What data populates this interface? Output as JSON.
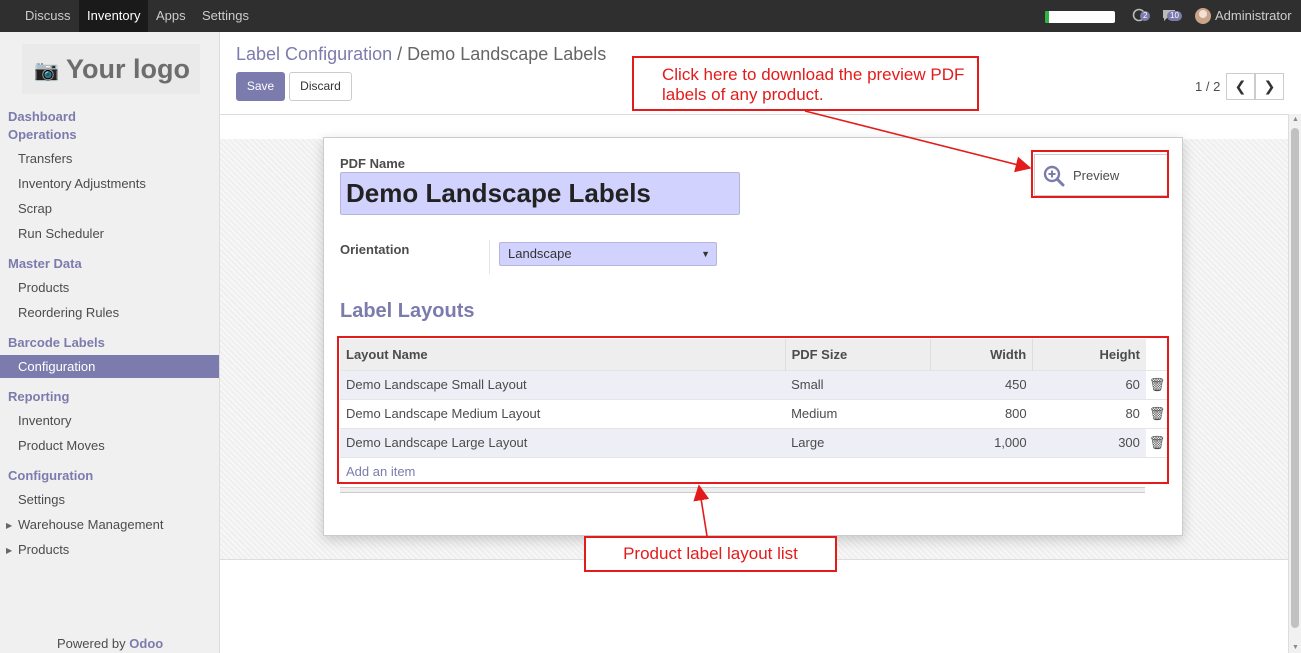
{
  "topbar": {
    "menus": [
      "Discuss",
      "Inventory",
      "Apps",
      "Settings"
    ],
    "active_menu": "Inventory",
    "chat_badge": "2",
    "messages_badge": "10",
    "user": "Administrator",
    "progress_fraction": 0.05
  },
  "sidebar": {
    "logo_text": "Your logo",
    "sections": [
      {
        "title": "Dashboard"
      },
      {
        "title": "Operations",
        "items": [
          "Transfers",
          "Inventory Adjustments",
          "Scrap",
          "Run Scheduler"
        ]
      },
      {
        "title": "Master Data",
        "items": [
          "Products",
          "Reordering Rules"
        ]
      },
      {
        "title": "Barcode Labels",
        "items": [
          "Configuration"
        ]
      },
      {
        "title": "Reporting",
        "items": [
          "Inventory",
          "Product Moves"
        ]
      },
      {
        "title": "Configuration",
        "items": [
          "Settings",
          "Warehouse Management",
          "Products"
        ]
      }
    ],
    "active_item": "Configuration",
    "powered_prefix": "Powered by",
    "powered_brand": "Odoo"
  },
  "breadcrumb": {
    "parent": "Label Configuration",
    "separator": "/",
    "current": "Demo Landscape Labels"
  },
  "buttons": {
    "save": "Save",
    "discard": "Discard",
    "preview": "Preview"
  },
  "pager": {
    "value": "1 / 2"
  },
  "form": {
    "pdf_name_label": "PDF Name",
    "pdf_name_value": "Demo Landscape Labels",
    "orientation_label": "Orientation",
    "orientation_value": "Landscape",
    "section_title": "Label Layouts"
  },
  "layouts_table": {
    "columns": [
      "Layout Name",
      "PDF Size",
      "Width",
      "Height"
    ],
    "rows": [
      [
        "Demo Landscape Small Layout",
        "Small",
        "450",
        "60"
      ],
      [
        "Demo Landscape Medium Layout",
        "Medium",
        "800",
        "80"
      ],
      [
        "Demo Landscape Large Layout",
        "Large",
        "1,000",
        "300"
      ]
    ],
    "add_item": "Add an item"
  },
  "annotations": {
    "preview_note": "Click here to download the preview PDF labels of any product.",
    "list_note": "Product label layout list"
  },
  "colors": {
    "accent": "#7c7bad",
    "annotation": "#e31b1b",
    "topbar": "#2f2f2f"
  }
}
